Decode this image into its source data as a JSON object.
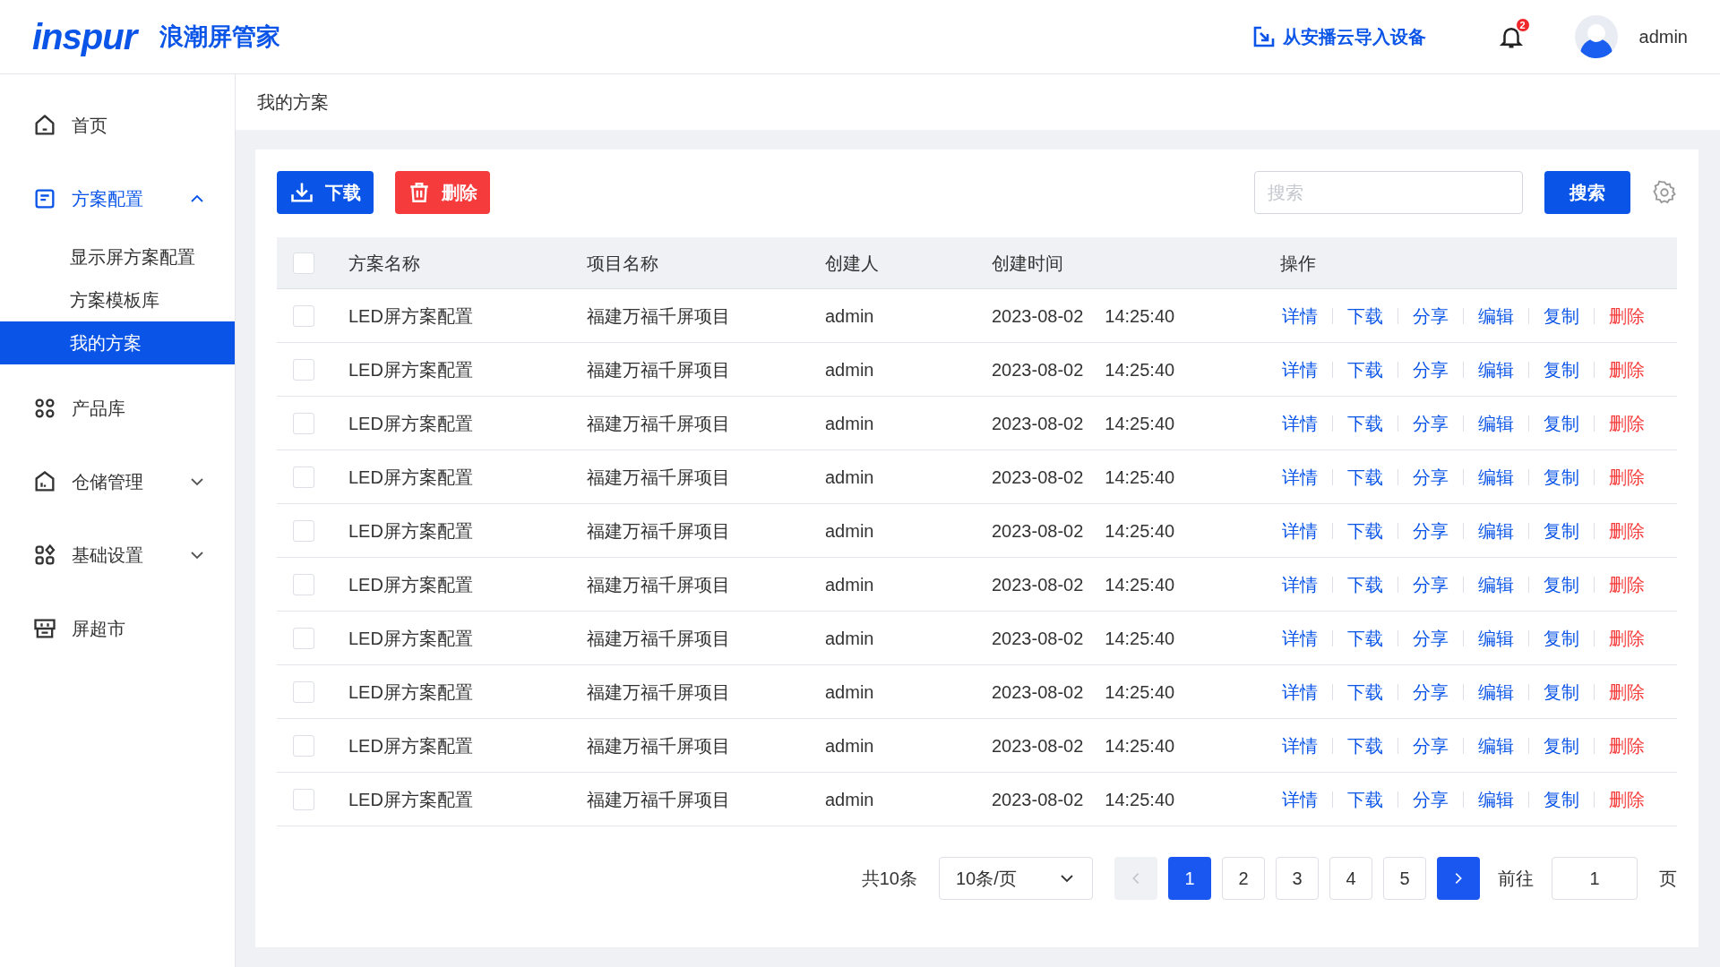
{
  "header": {
    "logo": "inspur",
    "app_name": "浪潮屏管家",
    "import_link": "从安播云导入设备",
    "notification_count": "2",
    "user": "admin"
  },
  "sidebar": {
    "items": [
      {
        "label": "首页",
        "selected": false
      },
      {
        "label": "方案配置",
        "selected": true,
        "expanded": true,
        "children": [
          {
            "label": "显示屏方案配置",
            "selected": false
          },
          {
            "label": "方案模板库",
            "selected": false
          },
          {
            "label": "我的方案",
            "selected": true
          }
        ]
      },
      {
        "label": "产品库",
        "selected": false
      },
      {
        "label": "仓储管理",
        "selected": false,
        "expanded": false
      },
      {
        "label": "基础设置",
        "selected": false,
        "expanded": false
      },
      {
        "label": "屏超市",
        "selected": false
      }
    ]
  },
  "breadcrumb": "我的方案",
  "toolbar": {
    "buttons": [
      {
        "label": "下载",
        "kind": "primary"
      },
      {
        "label": "删除",
        "kind": "danger"
      }
    ],
    "search": {
      "placeholder": "搜索"
    },
    "search_button": "搜索"
  },
  "table": {
    "columns": [
      "方案名称",
      "项目名称",
      "创建人",
      "创建时间",
      "操作"
    ],
    "select_all_checked": false,
    "rows": [
      {
        "checked": false,
        "name": "LED屏方案配置",
        "project": "福建万福千屏项目",
        "creator": "admin",
        "date": "2023-08-02",
        "time": "14:25:40",
        "actions": [
          {
            "label": "详情",
            "kind": "link"
          },
          {
            "label": "下载",
            "kind": "link"
          },
          {
            "label": "分享",
            "kind": "link"
          },
          {
            "label": "编辑",
            "kind": "link"
          },
          {
            "label": "复制",
            "kind": "link"
          },
          {
            "label": "删除",
            "kind": "danger"
          }
        ]
      },
      {
        "checked": false,
        "name": "LED屏方案配置",
        "project": "福建万福千屏项目",
        "creator": "admin",
        "date": "2023-08-02",
        "time": "14:25:40",
        "actions": [
          {
            "label": "详情",
            "kind": "link"
          },
          {
            "label": "下载",
            "kind": "link"
          },
          {
            "label": "分享",
            "kind": "link"
          },
          {
            "label": "编辑",
            "kind": "link"
          },
          {
            "label": "复制",
            "kind": "link"
          },
          {
            "label": "删除",
            "kind": "danger"
          }
        ]
      },
      {
        "checked": false,
        "name": "LED屏方案配置",
        "project": "福建万福千屏项目",
        "creator": "admin",
        "date": "2023-08-02",
        "time": "14:25:40",
        "actions": [
          {
            "label": "详情",
            "kind": "link"
          },
          {
            "label": "下载",
            "kind": "link"
          },
          {
            "label": "分享",
            "kind": "link"
          },
          {
            "label": "编辑",
            "kind": "link"
          },
          {
            "label": "复制",
            "kind": "link"
          },
          {
            "label": "删除",
            "kind": "danger"
          }
        ]
      },
      {
        "checked": false,
        "name": "LED屏方案配置",
        "project": "福建万福千屏项目",
        "creator": "admin",
        "date": "2023-08-02",
        "time": "14:25:40",
        "actions": [
          {
            "label": "详情",
            "kind": "link"
          },
          {
            "label": "下载",
            "kind": "link"
          },
          {
            "label": "分享",
            "kind": "link"
          },
          {
            "label": "编辑",
            "kind": "link"
          },
          {
            "label": "复制",
            "kind": "link"
          },
          {
            "label": "删除",
            "kind": "danger"
          }
        ]
      },
      {
        "checked": false,
        "name": "LED屏方案配置",
        "project": "福建万福千屏项目",
        "creator": "admin",
        "date": "2023-08-02",
        "time": "14:25:40",
        "actions": [
          {
            "label": "详情",
            "kind": "link"
          },
          {
            "label": "下载",
            "kind": "link"
          },
          {
            "label": "分享",
            "kind": "link"
          },
          {
            "label": "编辑",
            "kind": "link"
          },
          {
            "label": "复制",
            "kind": "link"
          },
          {
            "label": "删除",
            "kind": "danger"
          }
        ]
      },
      {
        "checked": false,
        "name": "LED屏方案配置",
        "project": "福建万福千屏项目",
        "creator": "admin",
        "date": "2023-08-02",
        "time": "14:25:40",
        "actions": [
          {
            "label": "详情",
            "kind": "link"
          },
          {
            "label": "下载",
            "kind": "link"
          },
          {
            "label": "分享",
            "kind": "link"
          },
          {
            "label": "编辑",
            "kind": "link"
          },
          {
            "label": "复制",
            "kind": "link"
          },
          {
            "label": "删除",
            "kind": "danger"
          }
        ]
      },
      {
        "checked": false,
        "name": "LED屏方案配置",
        "project": "福建万福千屏项目",
        "creator": "admin",
        "date": "2023-08-02",
        "time": "14:25:40",
        "actions": [
          {
            "label": "详情",
            "kind": "link"
          },
          {
            "label": "下载",
            "kind": "link"
          },
          {
            "label": "分享",
            "kind": "link"
          },
          {
            "label": "编辑",
            "kind": "link"
          },
          {
            "label": "复制",
            "kind": "link"
          },
          {
            "label": "删除",
            "kind": "danger"
          }
        ]
      },
      {
        "checked": false,
        "name": "LED屏方案配置",
        "project": "福建万福千屏项目",
        "creator": "admin",
        "date": "2023-08-02",
        "time": "14:25:40",
        "actions": [
          {
            "label": "详情",
            "kind": "link"
          },
          {
            "label": "下载",
            "kind": "link"
          },
          {
            "label": "分享",
            "kind": "link"
          },
          {
            "label": "编辑",
            "kind": "link"
          },
          {
            "label": "复制",
            "kind": "link"
          },
          {
            "label": "删除",
            "kind": "danger"
          }
        ]
      },
      {
        "checked": false,
        "name": "LED屏方案配置",
        "project": "福建万福千屏项目",
        "creator": "admin",
        "date": "2023-08-02",
        "time": "14:25:40",
        "actions": [
          {
            "label": "详情",
            "kind": "link"
          },
          {
            "label": "下载",
            "kind": "link"
          },
          {
            "label": "分享",
            "kind": "link"
          },
          {
            "label": "编辑",
            "kind": "link"
          },
          {
            "label": "复制",
            "kind": "link"
          },
          {
            "label": "删除",
            "kind": "danger"
          }
        ]
      },
      {
        "checked": false,
        "name": "LED屏方案配置",
        "project": "福建万福千屏项目",
        "creator": "admin",
        "date": "2023-08-02",
        "time": "14:25:40",
        "actions": [
          {
            "label": "详情",
            "kind": "link"
          },
          {
            "label": "下载",
            "kind": "link"
          },
          {
            "label": "分享",
            "kind": "link"
          },
          {
            "label": "编辑",
            "kind": "link"
          },
          {
            "label": "复制",
            "kind": "link"
          },
          {
            "label": "删除",
            "kind": "danger"
          }
        ]
      }
    ]
  },
  "pagination": {
    "total": "共10条",
    "page_size": "10条/页",
    "prev_disabled": true,
    "pages": [
      {
        "label": "1",
        "selected": true
      },
      {
        "label": "2",
        "selected": false
      },
      {
        "label": "3",
        "selected": false
      },
      {
        "label": "4",
        "selected": false
      },
      {
        "label": "5",
        "selected": false
      }
    ],
    "next_disabled": false,
    "goto_label": "前往",
    "goto_value": "1",
    "goto_suffix": "页"
  }
}
